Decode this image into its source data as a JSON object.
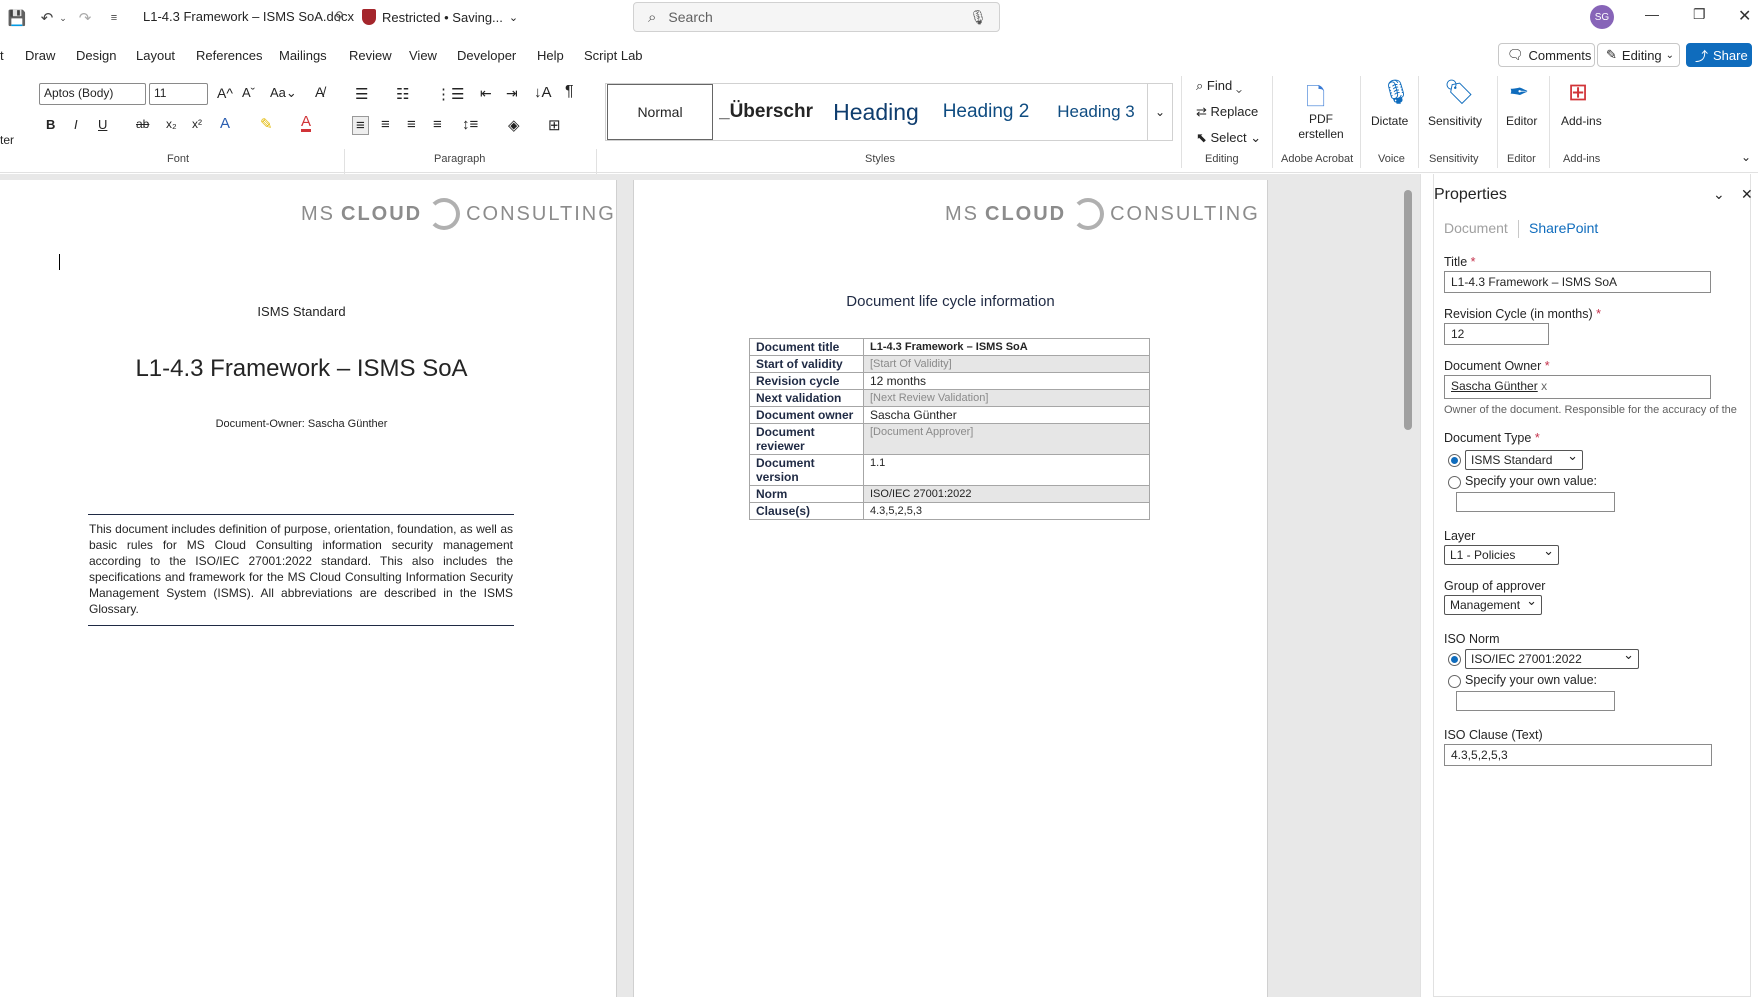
{
  "titlebar": {
    "doc_title": "L1-4.3 Framework – ISMS SoA.docx",
    "restricted": "Restricted • Saving...",
    "search_placeholder": "Search",
    "avatar": "SG"
  },
  "menu": [
    "t",
    "Draw",
    "Design",
    "Layout",
    "References",
    "Mailings",
    "Review",
    "View",
    "Developer",
    "Help",
    "Script Lab"
  ],
  "right_buttons": {
    "comments": "Comments",
    "editing": "Editing",
    "share": "Share"
  },
  "ribbon": {
    "font_name": "Aptos (Body)",
    "font_size": "11",
    "styles": [
      "Normal",
      "_Überschr",
      "Heading",
      "Heading 2",
      "Heading 3"
    ],
    "editing": {
      "find": "Find",
      "replace": "Replace",
      "select": "Select"
    },
    "pdf": "PDF erstellen",
    "dictate": "Dictate",
    "sensitivity": "Sensitivity",
    "editor": "Editor",
    "addins": "Add-ins",
    "groups": {
      "font": "Font",
      "paragraph": "Paragraph",
      "styles": "Styles",
      "editing": "Editing",
      "acrobat": "Adobe Acrobat",
      "voice": "Voice",
      "sensitivity": "Sensitivity",
      "editor": "Editor",
      "addins": "Add-ins"
    },
    "left_cut": "ter"
  },
  "page1": {
    "logo_ms": "MS",
    "logo_cloud": "CLOUD",
    "logo_consulting": "CONSULTING",
    "subtitle": "ISMS Standard",
    "title": "L1-4.3 Framework – ISMS SoA",
    "owner": "Document-Owner: Sascha Günther",
    "abstract": "This document includes definition of purpose, orientation, foundation, as well as basic rules for MS Cloud Consulting information security management according to the ISO/IEC 27001:2022 standard. This also includes the specifications and framework for the MS Cloud Consulting Information Security Management System (ISMS). All abbreviations are described in the ISMS Glossary."
  },
  "page2": {
    "heading": "Document life cycle information",
    "rows": [
      {
        "k": "Document title",
        "v": "L1-4.3 Framework – ISMS SoA"
      },
      {
        "k": "Start of validity",
        "v": "[Start Of Validity]"
      },
      {
        "k": "Revision cycle",
        "v": "12 months"
      },
      {
        "k": "Next validation",
        "v": "[Next Review Validation]"
      },
      {
        "k": "Document owner",
        "v": "Sascha Günther"
      },
      {
        "k": "Document reviewer",
        "v": "[Document Approver]"
      },
      {
        "k": "Document version",
        "v": "1.1"
      },
      {
        "k": "Norm",
        "v": "ISO/IEC 27001:2022"
      },
      {
        "k": "Clause(s)",
        "v": "4.3,5,2,5,3"
      }
    ]
  },
  "properties": {
    "title": "Properties",
    "tab_document": "Document",
    "tab_sharepoint": "SharePoint",
    "title_label": "Title",
    "title_value": "L1-4.3 Framework – ISMS SoA",
    "revision_label": "Revision Cycle (in months)",
    "revision_value": "12",
    "owner_label": "Document Owner",
    "owner_value": "Sascha Günther",
    "owner_help": "Owner of the document. Responsible for the accuracy of the",
    "doctype_label": "Document Type",
    "doctype_value": "ISMS Standard",
    "specify": "Specify your own value:",
    "layer_label": "Layer",
    "layer_value": "L1 - Policies",
    "approver_label": "Group of approver",
    "approver_value": "Management",
    "iso_label": "ISO Norm",
    "iso_value": "ISO/IEC 27001:2022",
    "clause_label": "ISO Clause (Text)",
    "clause_value": "4.3,5,2,5,3"
  }
}
